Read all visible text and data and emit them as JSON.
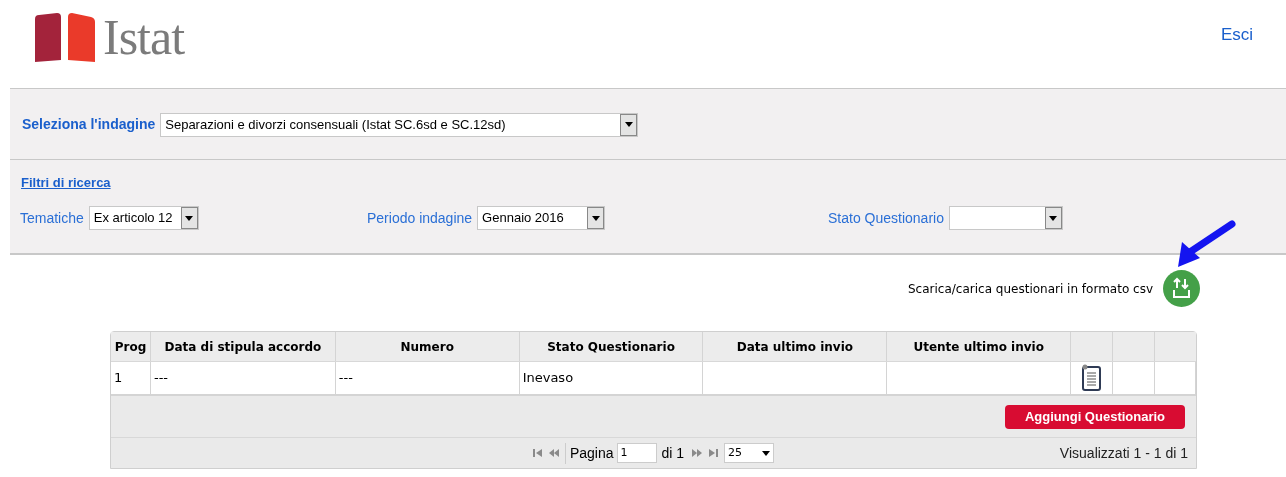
{
  "header": {
    "logo_text": "Istat",
    "logout_link": "Esci"
  },
  "survey_selector": {
    "label": "Seleziona l'indagine",
    "value": "Separazioni e divorzi consensuali (Istat SC.6sd e SC.12sd)"
  },
  "filters": {
    "title": "Filtri di ricerca",
    "fields": [
      {
        "label": "Tematiche",
        "value": "Ex articolo 12"
      },
      {
        "label": "Periodo indagine",
        "value": "Gennaio 2016"
      },
      {
        "label": "Stato Questionario"
      }
    ]
  },
  "csv_action": {
    "label": "Scarica/carica questionari in formato csv"
  },
  "table": {
    "columns": [
      "Prog",
      "Data di stipula accordo",
      "Numero",
      "Stato Questionario",
      "Data ultimo invio",
      "Utente ultimo invio"
    ],
    "rows": [
      {
        "cells": [
          "1",
          "---",
          "---",
          "Inevaso"
        ]
      }
    ]
  },
  "add_button": "Aggiungi Questionario",
  "pager": {
    "page_label": "Pagina",
    "page": "1",
    "page_total": "di 1",
    "page_size": "25",
    "summary": "Visualizzati 1 - 1 di 1"
  }
}
